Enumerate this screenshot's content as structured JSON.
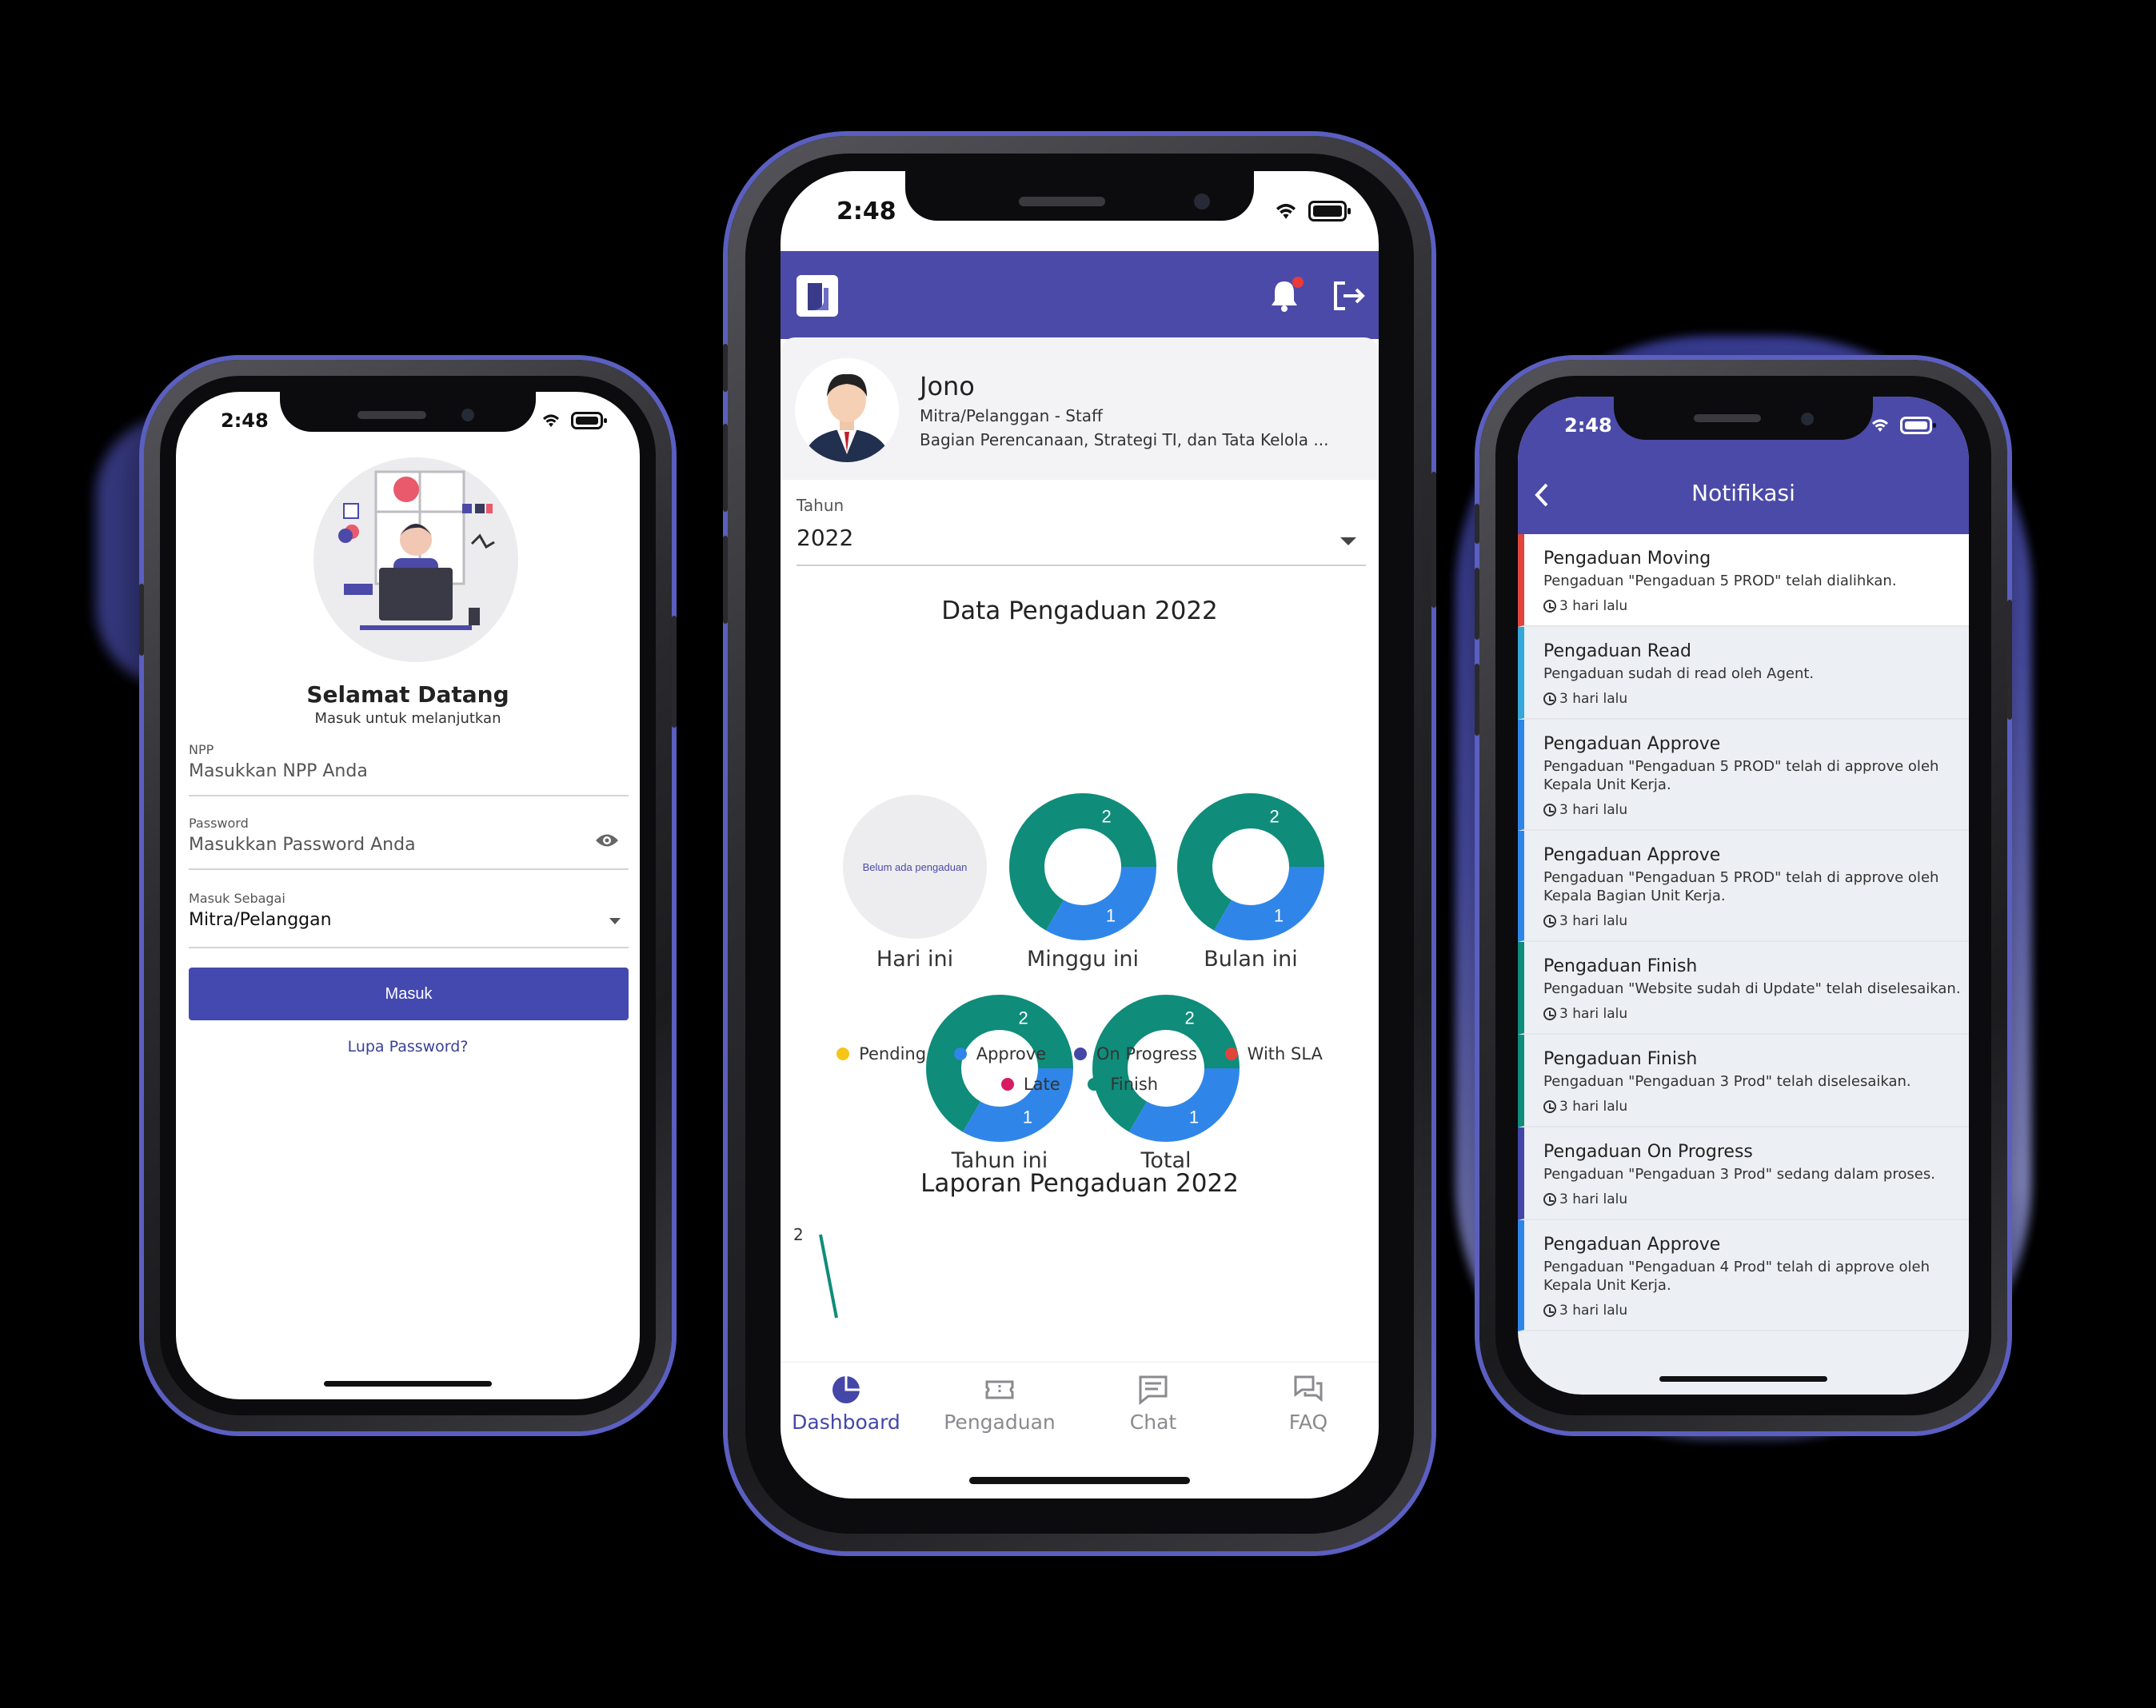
{
  "login": {
    "time": "2:48",
    "welcome_title": "Selamat Datang",
    "welcome_sub": "Masuk untuk melanjutkan",
    "npp_label": "NPP",
    "npp_placeholder": "Masukkan NPP Anda",
    "password_label": "Password",
    "password_placeholder": "Masukkan Password Anda",
    "role_label": "Masuk Sebagai",
    "role_value": "Mitra/Pelanggan",
    "login_button": "Masuk",
    "forgot_link": "Lupa Password?"
  },
  "dashboard": {
    "time": "2:48",
    "user_name": "Jono",
    "user_role": "Mitra/Pelanggan - Staff",
    "user_dept": "Bagian Perencanaan, Strategi TI, dan Tata Kelola ...",
    "year_label": "Tahun",
    "year_value": "2022",
    "data_title": "Data Pengaduan 2022",
    "empty_text": "Belum ada pengaduan",
    "donuts": [
      {
        "label": "Hari ini",
        "empty": true
      },
      {
        "label": "Minggu ini",
        "finish": 2,
        "approve": 1
      },
      {
        "label": "Bulan ini",
        "finish": 2,
        "approve": 1
      },
      {
        "label": "Tahun ini",
        "finish": 2,
        "approve": 1
      },
      {
        "label": "Total",
        "finish": 2,
        "approve": 1
      }
    ],
    "legend": [
      {
        "name": "Pending",
        "color": "#f5c518"
      },
      {
        "name": "Approve",
        "color": "#2f86e8"
      },
      {
        "name": "On Progress",
        "color": "#4447a8"
      },
      {
        "name": "With SLA",
        "color": "#e0443a"
      },
      {
        "name": "Late",
        "color": "#d81b60"
      },
      {
        "name": "Finish",
        "color": "#0f8c7a"
      }
    ],
    "report_title": "Laporan Pengaduan 2022",
    "report_y_tick": "2",
    "nav": [
      {
        "label": "Dashboard",
        "icon": "pie-chart-icon",
        "active": true
      },
      {
        "label": "Pengaduan",
        "icon": "ticket-icon"
      },
      {
        "label": "Chat",
        "icon": "chat-icon"
      },
      {
        "label": "FAQ",
        "icon": "faq-icon"
      }
    ],
    "colors": {
      "primary": "#4b4aa8",
      "finish": "#0f8c7a",
      "approve": "#2f86e8"
    }
  },
  "notifications": {
    "time": "2:48",
    "title": "Notifikasi",
    "items": [
      {
        "title": "Pengaduan Moving",
        "desc": "Pengaduan \"Pengaduan 5 PROD\" telah dialihkan.",
        "time": "3 hari lalu",
        "color": "#e0443a"
      },
      {
        "title": "Pengaduan Read",
        "desc": "Pengaduan sudah di read oleh Agent.",
        "time": "3 hari lalu",
        "color": "#35a7d8"
      },
      {
        "title": "Pengaduan Approve",
        "desc": "Pengaduan \"Pengaduan 5 PROD\" telah di approve oleh Kepala Unit Kerja.",
        "time": "3 hari lalu",
        "color": "#2f86e8"
      },
      {
        "title": "Pengaduan Approve",
        "desc": "Pengaduan \"Pengaduan 5 PROD\" telah di approve oleh Kepala Bagian Unit Kerja.",
        "time": "3 hari lalu",
        "color": "#2f86e8"
      },
      {
        "title": "Pengaduan Finish",
        "desc": "Pengaduan \"Website sudah di Update\" telah diselesaikan.",
        "time": "3 hari lalu",
        "color": "#0f8c7a"
      },
      {
        "title": "Pengaduan Finish",
        "desc": "Pengaduan \"Pengaduan 3 Prod\" telah diselesaikan.",
        "time": "3 hari lalu",
        "color": "#0f8c7a"
      },
      {
        "title": "Pengaduan On Progress",
        "desc": "Pengaduan \"Pengaduan 3 Prod\" sedang dalam proses.",
        "time": "3 hari lalu",
        "color": "#4447a8"
      },
      {
        "title": "Pengaduan Approve",
        "desc": "Pengaduan \"Pengaduan 4 Prod\" telah di approve oleh Kepala Unit Kerja.",
        "time": "3 hari lalu",
        "color": "#2f86e8"
      }
    ]
  }
}
